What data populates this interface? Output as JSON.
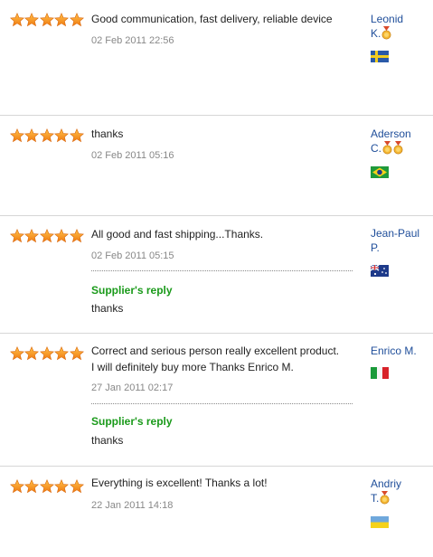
{
  "reviews": [
    {
      "rating": 5,
      "comment": "Good communication, fast delivery, reliable device",
      "date": "02 Feb 2011 22:56",
      "user_line1": "Leonid",
      "user_line2": "K.",
      "medals": 1,
      "country_flag": "sweden-flag"
    },
    {
      "rating": 5,
      "comment": "thanks",
      "date": "02 Feb 2011 05:16",
      "user_line1": "Aderson",
      "user_line2": "C.",
      "medals": 2,
      "country_flag": "brazil-flag"
    },
    {
      "rating": 5,
      "comment": "All good and fast shipping...Thanks.",
      "date": "02 Feb 2011 05:15",
      "reply_label": "Supplier's reply",
      "reply_text": "thanks",
      "user_line1": "Jean-Paul",
      "user_line2": "P.",
      "medals": 0,
      "country_flag": "australia-flag"
    },
    {
      "rating": 5,
      "comment_line1": "Correct and serious person really excellent product.",
      "comment_line2": "I will definitely buy more Thanks Enrico M.",
      "date": "27 Jan 2011 02:17",
      "reply_label": "Supplier's reply",
      "reply_text": "thanks",
      "user_line1": "Enrico M.",
      "medals": 0,
      "country_flag": "italy-flag"
    },
    {
      "rating": 5,
      "comment": "Everything is excellent! Thanks a lot!",
      "date": "22 Jan 2011 14:18",
      "user_line1": "Andriy",
      "user_line2": "T.",
      "medals": 1,
      "country_flag": "ukraine-flag"
    }
  ],
  "colors": {
    "star": "#f7941d",
    "user_link": "#1f4e9a",
    "reply_label": "#1a9a1a",
    "date": "#888888"
  }
}
